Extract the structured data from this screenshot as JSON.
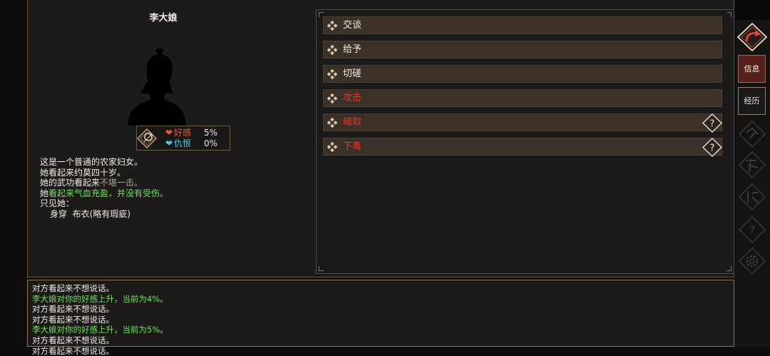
{
  "npc": {
    "name": "李大娘",
    "relations": [
      {
        "label": "好感",
        "value": "5%"
      },
      {
        "label": "仇恨",
        "value": "0%"
      }
    ]
  },
  "description": {
    "line1": "这是一个普通的农家妇女。",
    "line2": "她看起来约莫四十岁。",
    "line3_prefix": "她的武功看起来",
    "line3_value": "不堪一击。",
    "line4_prefix": "她",
    "line4_value": "看起来气血充盈，并没有受伤。",
    "line5": "只见她：",
    "line6_slot": "身穿",
    "line6_item": "布衣(略有瑕疵)"
  },
  "actions": [
    {
      "label": "交谈",
      "color": "white",
      "help": false
    },
    {
      "label": "给予",
      "color": "white",
      "help": false
    },
    {
      "label": "切磋",
      "color": "white",
      "help": false
    },
    {
      "label": "攻击",
      "color": "red",
      "help": false
    },
    {
      "label": "暗取",
      "color": "red",
      "help": true
    },
    {
      "label": "下毒",
      "color": "red",
      "help": true
    }
  ],
  "sidebar": {
    "tab_info": "信息",
    "tab_history": "经历",
    "icons": [
      "return-icon",
      "rank-icon",
      "martial-icon",
      "school-icon",
      "question-icon",
      "gear-icon"
    ]
  },
  "log": [
    {
      "text": "对方看起来不想说话。",
      "color": "white"
    },
    {
      "text": "李大娘对你的好感上升，当前为4%。",
      "color": "green"
    },
    {
      "text": "对方看起来不想说话。",
      "color": "white"
    },
    {
      "text": "对方看起来不想说话。",
      "color": "white"
    },
    {
      "text": "李大娘对你的好感上升，当前为5%。",
      "color": "green"
    },
    {
      "text": "对方看起来不想说话。",
      "color": "white"
    },
    {
      "text": "对方看起来不想说话。",
      "color": "white"
    }
  ],
  "colors": {
    "green": "#6fe05a",
    "red": "#e5382c",
    "favor": "#e7573b",
    "hatred": "#52c3e0"
  }
}
